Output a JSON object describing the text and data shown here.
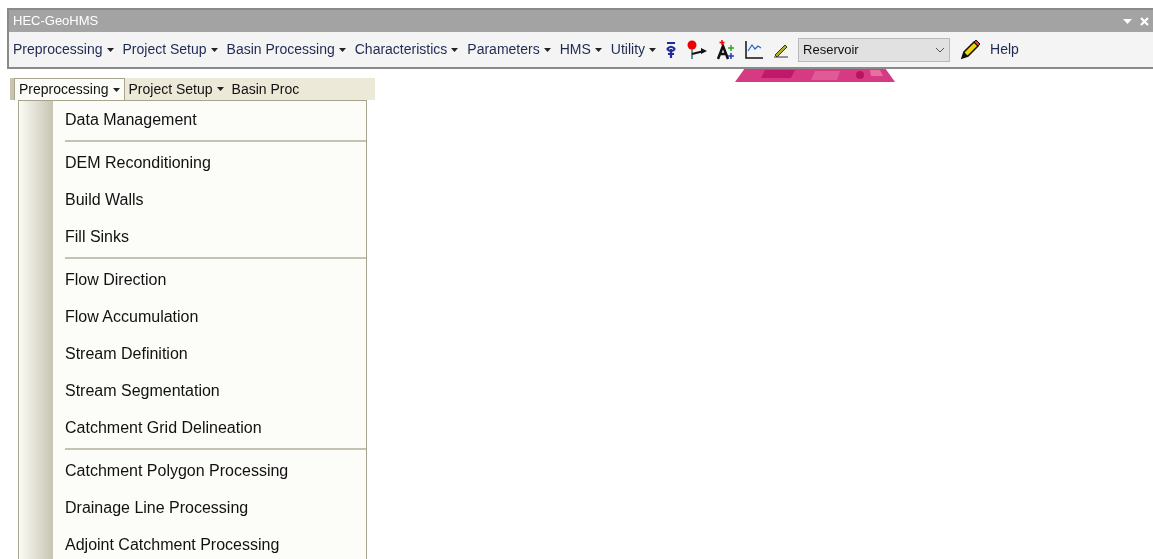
{
  "window": {
    "title": "HEC-GeoHMS"
  },
  "menu_bar": [
    "Preprocessing",
    "Project Setup",
    "Basin Processing",
    "Characteristics",
    "Parameters",
    "HMS",
    "Utility"
  ],
  "layer_dropdown": {
    "value": "Reservoir"
  },
  "help_label": "Help",
  "docked_menu_bar": [
    {
      "label": "Preprocessing",
      "selected": true,
      "caret": true
    },
    {
      "label": "Project Setup",
      "selected": false,
      "caret": true
    },
    {
      "label": "Basin Proc",
      "selected": false,
      "caret": false
    }
  ],
  "open_menu": {
    "groups": [
      [
        "Data Management"
      ],
      [
        "DEM Reconditioning",
        "Build Walls",
        "Fill Sinks"
      ],
      [
        "Flow Direction",
        "Flow Accumulation",
        "Stream Definition",
        "Stream Segmentation",
        "Catchment Grid Delineation"
      ],
      [
        "Catchment Polygon Processing",
        "Drainage Line Processing",
        "Adjoint Catchment Processing"
      ]
    ]
  }
}
